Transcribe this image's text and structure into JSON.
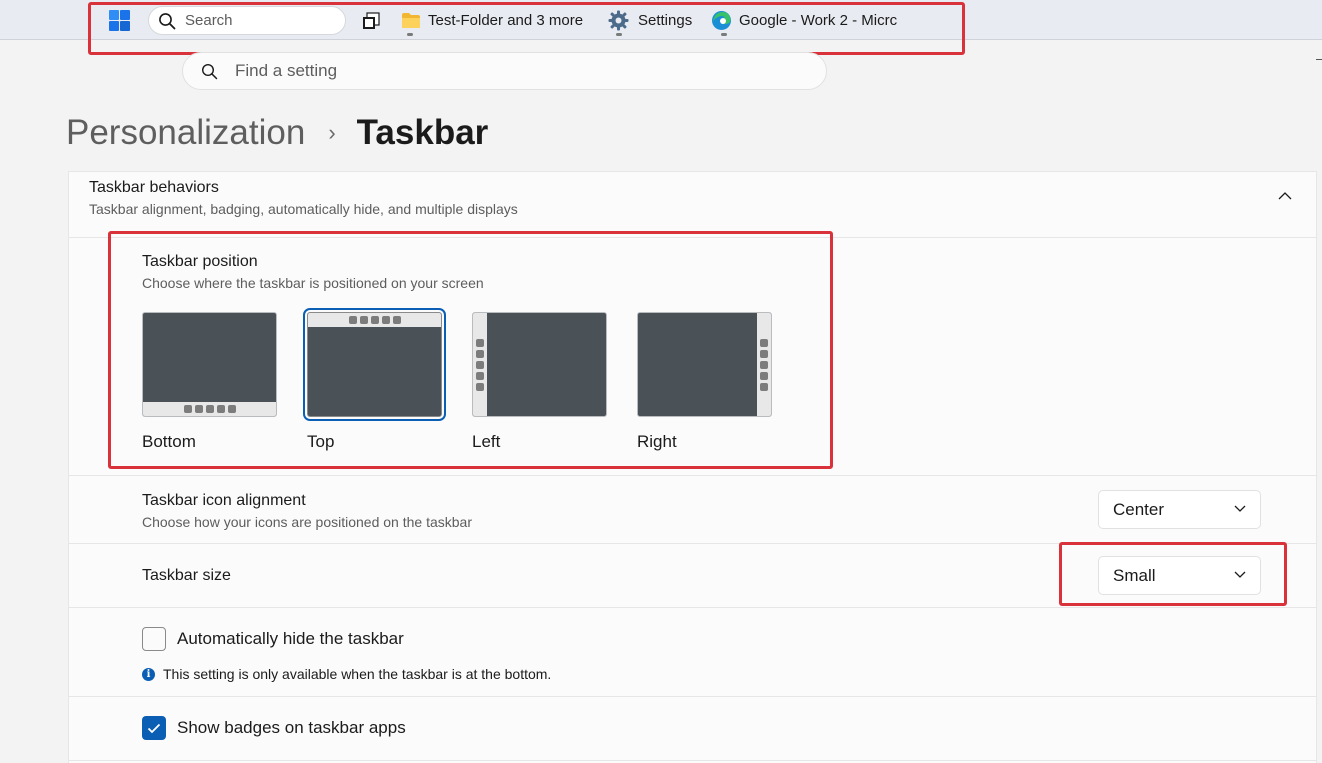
{
  "taskbar": {
    "search_label": "Search",
    "apps": [
      {
        "name": "file-explorer",
        "label": "Test-Folder and 3 more"
      },
      {
        "name": "settings",
        "label": "Settings"
      },
      {
        "name": "edge",
        "label": "Google - Work 2 - Micrc"
      }
    ]
  },
  "find_setting": {
    "placeholder": "Find a setting"
  },
  "breadcrumb": {
    "parent": "Personalization",
    "separator": "›",
    "current": "Taskbar"
  },
  "behaviors": {
    "title": "Taskbar behaviors",
    "description": "Taskbar alignment, badging, automatically hide, and multiple displays",
    "expanded": true
  },
  "position": {
    "title": "Taskbar position",
    "description": "Choose where the taskbar is positioned on your screen",
    "options": [
      {
        "label": "Bottom",
        "selected": false
      },
      {
        "label": "Top",
        "selected": true
      },
      {
        "label": "Left",
        "selected": false
      },
      {
        "label": "Right",
        "selected": false
      }
    ]
  },
  "alignment": {
    "title": "Taskbar icon alignment",
    "description": "Choose how your icons are positioned on the taskbar",
    "value": "Center"
  },
  "size": {
    "title": "Taskbar size",
    "value": "Small"
  },
  "auto_hide": {
    "label": "Automatically hide the taskbar",
    "checked": false,
    "note": "This setting is only available when the taskbar is at the bottom."
  },
  "badges": {
    "label": "Show badges on taskbar apps",
    "checked": true
  },
  "colors": {
    "accent": "#0a5fb4",
    "highlight": "#d9323b"
  }
}
